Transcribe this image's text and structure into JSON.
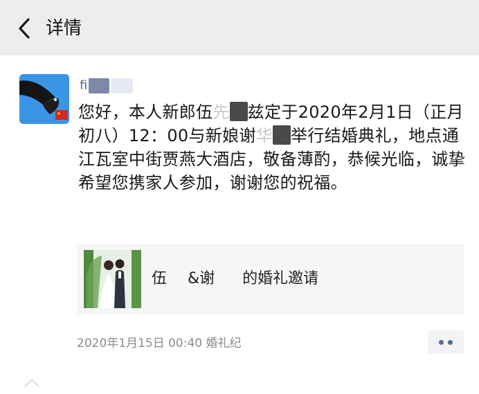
{
  "header": {
    "title": "详情",
    "back_icon": "chevron-left-icon"
  },
  "post": {
    "author_name": "fi",
    "message_parts": [
      "您好，本人新郎伍",
      "兹定于2020年2月1日（正月初八）12：00与新娘谢",
      "举行结婚典礼，地点通江瓦室中街贾燕大酒店，敬备薄酌，恭候光临，诚挚希望您携家人参加，谢谢您的祝福。"
    ],
    "message_ghosts": [
      "先",
      "华"
    ],
    "link_card": {
      "title_prefix": "伍",
      "title_middle": "&谢",
      "title_suffix": "的婚礼邀请"
    },
    "timestamp": "2020年1月15日 00:40",
    "source": "婚礼纪",
    "more_icon": "more-dots-icon"
  }
}
